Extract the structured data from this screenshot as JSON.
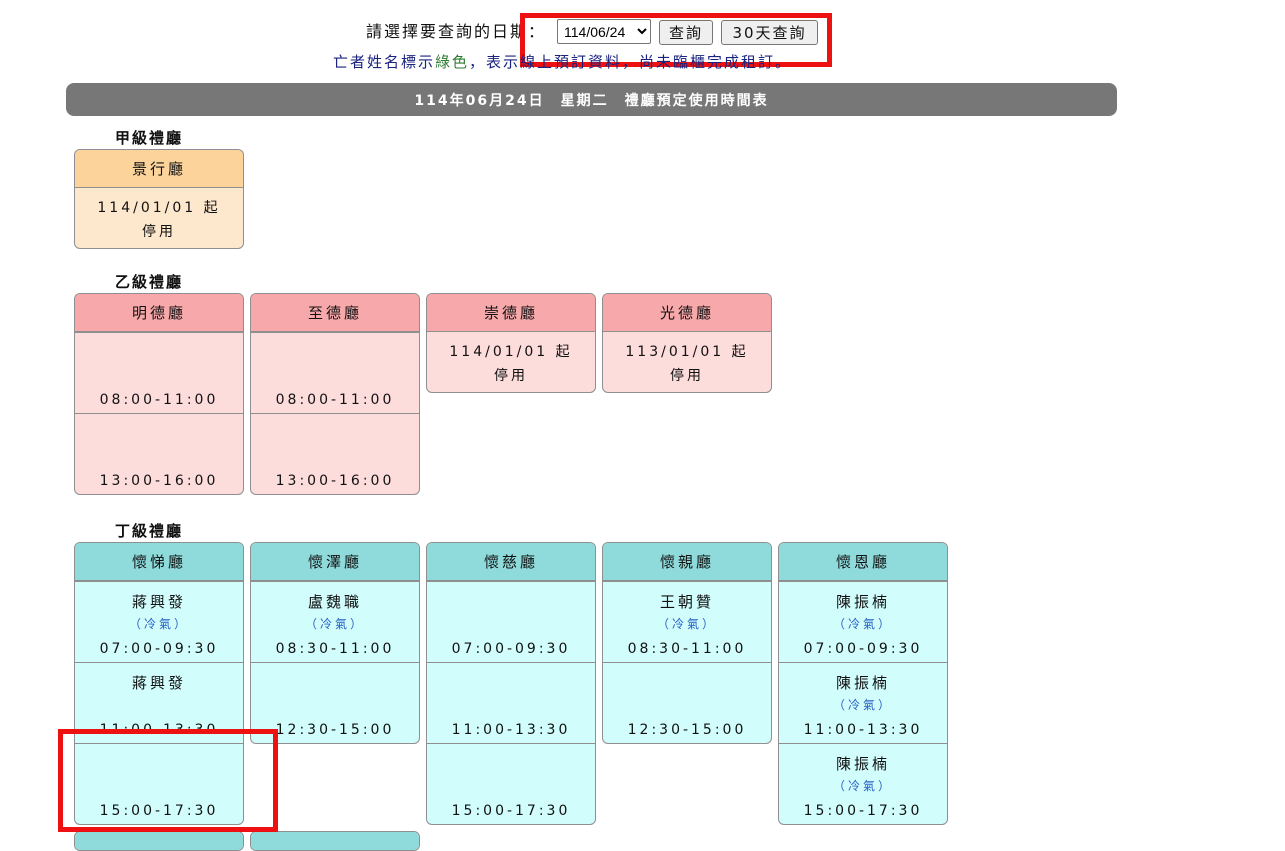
{
  "topbar": {
    "date_label": "請選擇要查詢的日期：",
    "selected_date": "114/06/24",
    "query_button": "查詢",
    "query30_button": "30天查詢"
  },
  "note": {
    "part1": "亡者姓名標示",
    "green_word": "綠色",
    "part2": "，表示線上預訂資料，尚未臨櫃完成租訂。"
  },
  "banner": "114年06月24日　星期二　禮廳預定使用時間表",
  "sections": {
    "a": {
      "title": "甲級禮廳",
      "halls": [
        {
          "name": "景行廳",
          "status": "114/01/01 起",
          "status2": "停用"
        }
      ]
    },
    "b": {
      "title": "乙級禮廳",
      "halls": [
        {
          "name": "明德廳",
          "slots": [
            {
              "time": "08:00-11:00"
            },
            {
              "time": "13:00-16:00"
            }
          ]
        },
        {
          "name": "至德廳",
          "slots": [
            {
              "time": "08:00-11:00"
            },
            {
              "time": "13:00-16:00"
            }
          ]
        },
        {
          "name": "崇德廳",
          "status": "114/01/01 起",
          "status2": "停用"
        },
        {
          "name": "光德廳",
          "status": "113/01/01 起",
          "status2": "停用"
        }
      ]
    },
    "d": {
      "title": "丁級禮廳",
      "halls": [
        {
          "name": "懷悌廳",
          "slots": [
            {
              "name": "蔣興發",
              "ac": "（冷氣）",
              "time": "07:00-09:30"
            },
            {
              "name": "蔣興發",
              "time": "11:00-13:30"
            },
            {
              "time": "15:00-17:30"
            }
          ]
        },
        {
          "name": "懷澤廳",
          "slots": [
            {
              "name": "盧魏職",
              "ac": "（冷氣）",
              "time": "08:30-11:00"
            },
            {
              "time": "12:30-15:00"
            }
          ]
        },
        {
          "name": "懷慈廳",
          "slots": [
            {
              "time": "07:00-09:30"
            },
            {
              "time": "11:00-13:30"
            },
            {
              "time": "15:00-17:30"
            }
          ]
        },
        {
          "name": "懷親廳",
          "slots": [
            {
              "name": "王朝贊",
              "ac": "（冷氣）",
              "time": "08:30-11:00"
            },
            {
              "time": "12:30-15:00"
            }
          ]
        },
        {
          "name": "懷恩廳",
          "slots": [
            {
              "name": "陳振楠",
              "ac": "（冷氣）",
              "time": "07:00-09:30"
            },
            {
              "name": "陳振楠",
              "ac": "（冷氣）",
              "time": "11:00-13:30"
            },
            {
              "name": "陳振楠",
              "ac": "（冷氣）",
              "time": "15:00-17:30"
            }
          ]
        }
      ]
    }
  }
}
